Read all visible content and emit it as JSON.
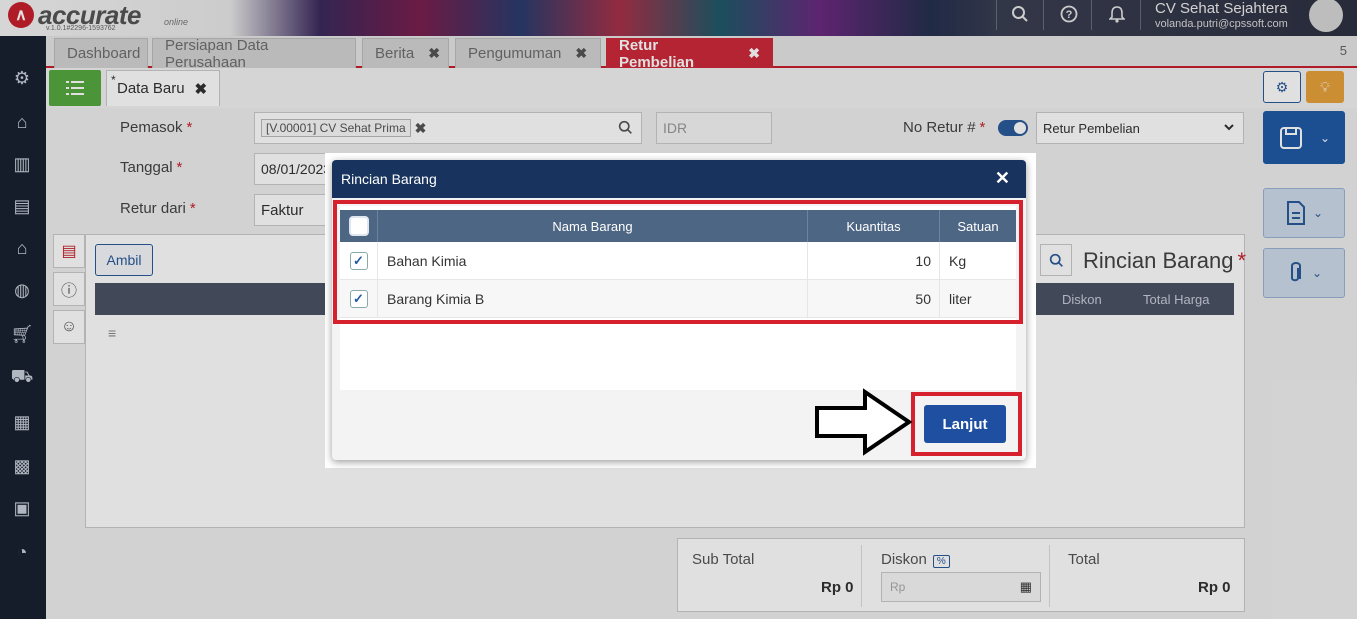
{
  "app": {
    "brand": "accurate",
    "brand_sub": "online",
    "version": "v.1.0.1#2296-1593762",
    "company": "CV Sehat Sejahtera",
    "email": "volanda.putri@cpssoft.com"
  },
  "tabs": [
    {
      "label": "Dashboard"
    },
    {
      "label": "Persiapan Data Perusahaan"
    },
    {
      "label": "Berita"
    },
    {
      "label": "Pengumuman"
    },
    {
      "label": "Retur Pembelian"
    }
  ],
  "tabs_count": "5",
  "subtab": {
    "star": "*",
    "label": "Data Baru",
    "close": "✖"
  },
  "form": {
    "pemasok_label": "Pemasok",
    "pemasok_value": "[V.00001] CV Sehat Prima",
    "currency": "IDR",
    "tanggal_label": "Tanggal",
    "tanggal_value": "08/01/2023",
    "retur_dari_label": "Retur dari",
    "retur_dari_value": "Faktur",
    "no_retur_label": "No Retur #",
    "no_retur_type": "Retur Pembelian",
    "required_mark": "*"
  },
  "detail": {
    "ambil_label": "Ambil",
    "title": "Rincian Barang",
    "columns_visible": [
      "Diskon",
      "Total Harga"
    ]
  },
  "totals": {
    "sub_total_label": "Sub Total",
    "sub_total_value": "Rp 0",
    "diskon_label": "Diskon",
    "diskon_pct": "%",
    "diskon_placeholder": "Rp",
    "total_label": "Total",
    "total_value": "Rp 0"
  },
  "modal": {
    "title": "Rincian Barang",
    "close": "✕",
    "columns": [
      "Nama Barang",
      "Kuantitas",
      "Satuan"
    ],
    "rows": [
      {
        "nama": "Bahan Kimia",
        "kuantitas": "10",
        "satuan": "Kg",
        "checked": true
      },
      {
        "nama": "Barang Kimia B",
        "kuantitas": "50",
        "satuan": "liter",
        "checked": true
      }
    ],
    "lanjut_label": "Lanjut"
  },
  "colors": {
    "accent_red": "#d7202e",
    "primary_blue": "#1f4fa0",
    "modal_header": "#18345e",
    "table_header": "#4d6684"
  }
}
